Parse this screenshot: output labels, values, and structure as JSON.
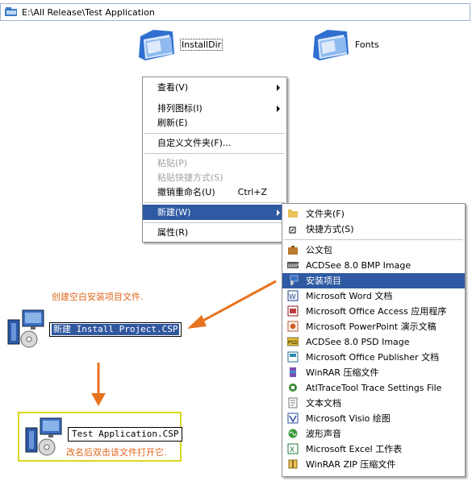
{
  "address_bar": {
    "path": "E:\\All Release\\Test Application"
  },
  "folders": [
    {
      "label": "InstallDir"
    },
    {
      "label": "Fonts"
    }
  ],
  "context_menu": {
    "items": [
      {
        "label": "查看(V)"
      },
      {
        "label": "排列图标(I)"
      },
      {
        "label": "刷新(E)"
      },
      {
        "label": "自定义文件夹(F)..."
      },
      {
        "label": "粘贴(P)"
      },
      {
        "label": "粘贴快捷方式(S)"
      },
      {
        "label": "撤销重命名(U)",
        "shortcut": "Ctrl+Z"
      },
      {
        "label": "新建(W)"
      },
      {
        "label": "属性(R)"
      }
    ]
  },
  "new_submenu": {
    "items": [
      {
        "label": "文件夹(F)",
        "icon": "folder-icon"
      },
      {
        "label": "快捷方式(S)",
        "icon": "shortcut-icon"
      },
      {
        "label": "公文包",
        "icon": "briefcase-icon"
      },
      {
        "label": "ACDSee 8.0 BMP Image",
        "icon": "bmp-icon"
      },
      {
        "label": "安装项目",
        "icon": "installer-icon"
      },
      {
        "label": "Microsoft Word 文档",
        "icon": "word-icon"
      },
      {
        "label": "Microsoft Office Access 应用程序",
        "icon": "access-icon"
      },
      {
        "label": "Microsoft PowerPoint 演示文稿",
        "icon": "powerpoint-icon"
      },
      {
        "label": "ACDSee 8.0 PSD Image",
        "icon": "psd-icon"
      },
      {
        "label": "Microsoft Office Publisher 文档",
        "icon": "publisher-icon"
      },
      {
        "label": "WinRAR 压缩文件",
        "icon": "winrar-icon"
      },
      {
        "label": "AtlTraceTool Trace Settings File",
        "icon": "trace-icon"
      },
      {
        "label": "文本文档",
        "icon": "text-file-icon"
      },
      {
        "label": "Microsoft Visio 绘图",
        "icon": "visio-icon"
      },
      {
        "label": "波形声音",
        "icon": "wave-icon"
      },
      {
        "label": "Microsoft Excel 工作表",
        "icon": "excel-icon"
      },
      {
        "label": "WinRAR ZIP 压缩文件",
        "icon": "zip-icon"
      }
    ]
  },
  "annotations": {
    "create_note": "创建空白安装项目文件.",
    "rename_note": "改名后双击该文件打开它."
  },
  "new_file": {
    "name_prefix": "新建",
    "name_rest": " Install Project.CSP"
  },
  "renamed_file": {
    "name": "Test Application.CSP"
  },
  "colors": {
    "highlight": "#2f5aa3",
    "annotation": "#e0651b",
    "box_border": "#d8d81f"
  }
}
